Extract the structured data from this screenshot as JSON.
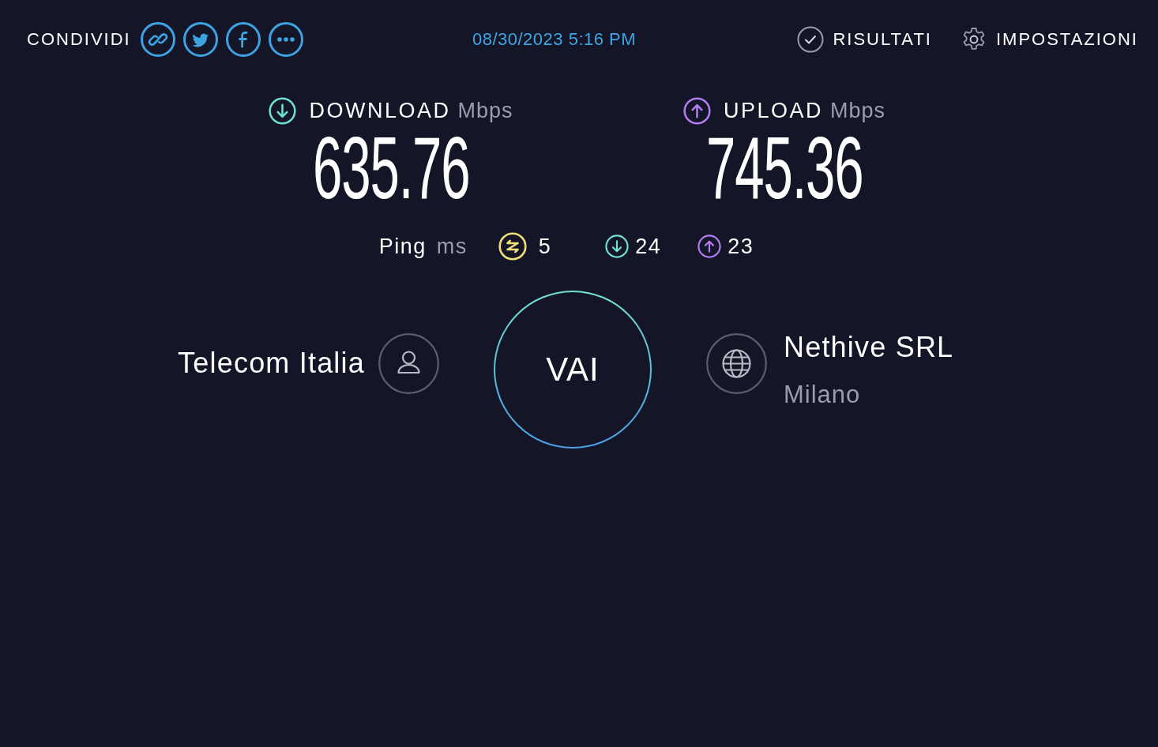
{
  "header": {
    "share_label": "CONDIVIDI",
    "share_buttons": [
      {
        "kind": "link"
      },
      {
        "kind": "twitter"
      },
      {
        "kind": "facebook"
      },
      {
        "kind": "more"
      }
    ],
    "timestamp": "08/30/2023 5:16 PM",
    "nav": [
      {
        "kind": "results",
        "label": "RISULTATI"
      },
      {
        "kind": "settings",
        "label": "IMPOSTAZIONI"
      }
    ]
  },
  "speeds": [
    {
      "kind": "download",
      "label": "DOWNLOAD",
      "unit": "Mbps",
      "value": "635.76"
    },
    {
      "kind": "upload",
      "label": "UPLOAD",
      "unit": "Mbps",
      "value": "745.36"
    }
  ],
  "ping": {
    "label": "Ping",
    "unit": "ms",
    "readings": [
      {
        "kind": "idle",
        "value": "5"
      },
      {
        "kind": "download",
        "value": "24"
      },
      {
        "kind": "upload",
        "value": "23"
      }
    ]
  },
  "isp": {
    "name": "Telecom Italia"
  },
  "go_button": {
    "label": "VAI"
  },
  "server": {
    "name": "Nethive SRL",
    "location": "Milano"
  }
}
